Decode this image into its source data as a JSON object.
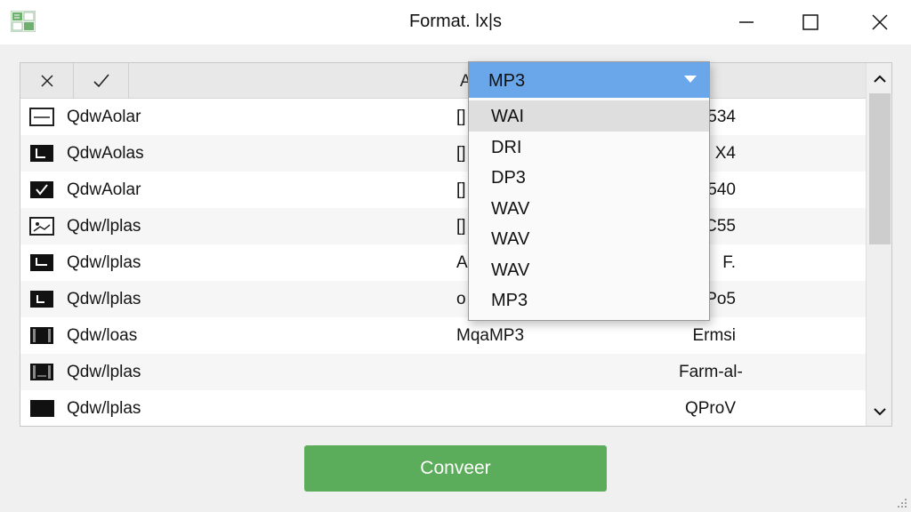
{
  "window": {
    "title": "Format. lx|s"
  },
  "table": {
    "header_partial_label": "A",
    "rows": [
      {
        "name": "QdwAolar",
        "format": "[]",
        "right": "534"
      },
      {
        "name": "QdwAolas",
        "format": "[]",
        "right": "X4"
      },
      {
        "name": "QdwAolar",
        "format": "[]",
        "right": "540"
      },
      {
        "name": "Qdw/lplas",
        "format": "[]",
        "right": "C55"
      },
      {
        "name": "Qdw/lplas",
        "format": "A",
        "right": "F."
      },
      {
        "name": "Qdw/lplas",
        "format": "o",
        "right": "Po5"
      },
      {
        "name": "Qdw/loas",
        "format": "MqaMP3",
        "right": "Ermsi"
      },
      {
        "name": "Qdw/lplas",
        "format": "",
        "right": "Farm-al-"
      },
      {
        "name": "Qdw/lplas",
        "format": "",
        "right": "QProV"
      }
    ]
  },
  "dropdown": {
    "selected": "MP3",
    "options": [
      "WAI",
      "DRI",
      "DP3",
      "WAV",
      "WAV",
      "WAV",
      "MP3"
    ],
    "hovered_index": 0,
    "accent_color": "#6aa7ea"
  },
  "convert_button": {
    "label": "Conveer",
    "color": "#5bac5b"
  },
  "icons": {
    "app": "app-grid-icon",
    "minimize": "minimize-icon",
    "maximize": "maximize-icon",
    "close": "close-icon",
    "header_clear": "close-icon",
    "header_confirm": "check-icon",
    "dropdown_arrow": "chevron-down-icon",
    "scroll_up": "chevron-up-icon",
    "scroll_down": "chevron-down-icon"
  }
}
